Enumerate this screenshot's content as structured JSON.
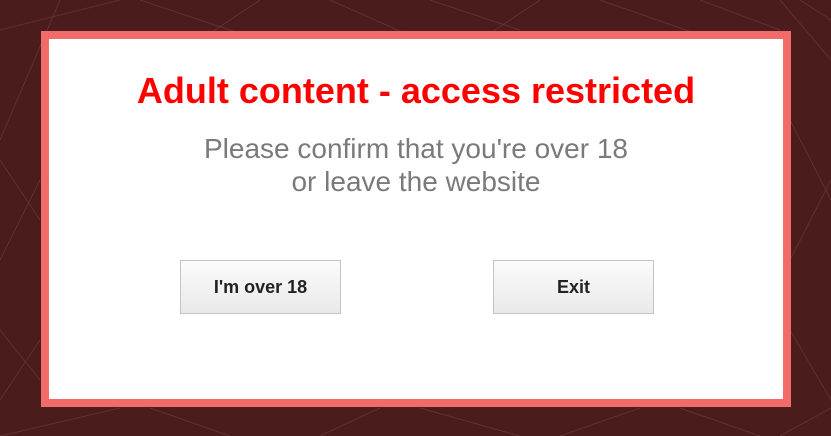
{
  "colors": {
    "background": "#4a1c1c",
    "frame": "#f26b6b",
    "title": "#ff0000",
    "message": "#7a7a7a"
  },
  "dialog": {
    "title": "Adult content - access restricted",
    "message_line_1": "Please confirm that you're over 18",
    "message_line_2": "or leave the website",
    "confirm_label": "I'm over 18",
    "exit_label": "Exit"
  }
}
